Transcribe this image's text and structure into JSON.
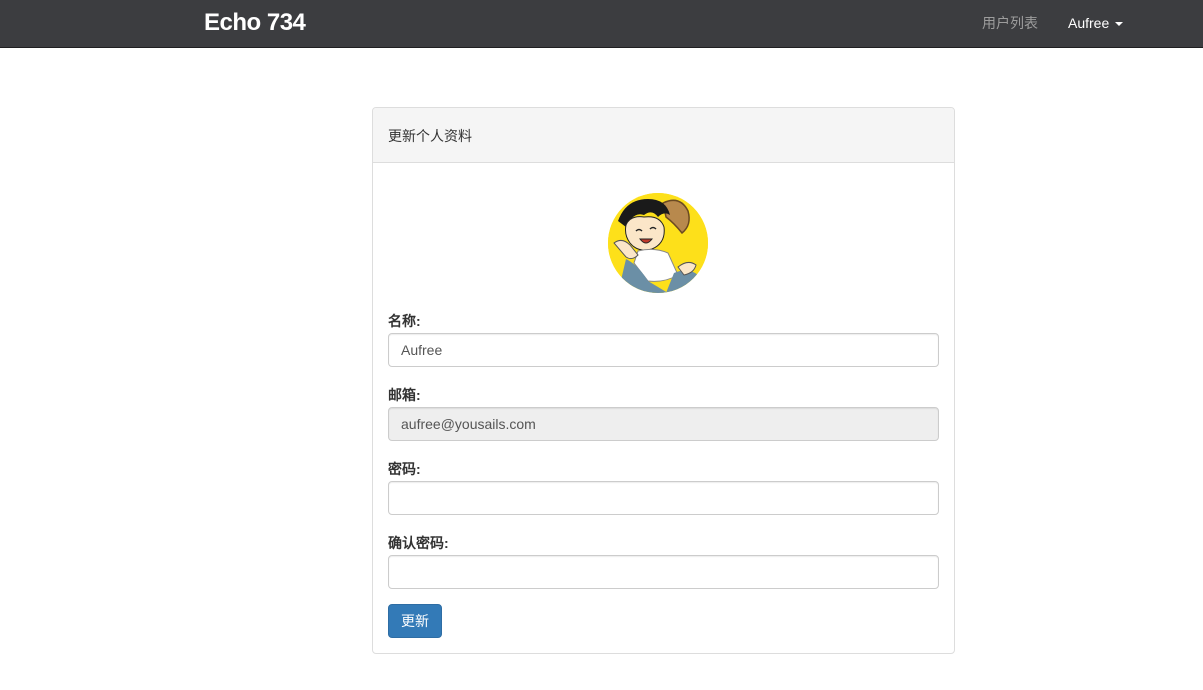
{
  "navbar": {
    "brand": "Echo 734",
    "users_link": "用户列表",
    "user_menu": "Aufree"
  },
  "panel": {
    "heading": "更新个人资料",
    "avatar_icon": "avatar-image",
    "fields": {
      "name": {
        "label": "名称:",
        "value": "Aufree"
      },
      "email": {
        "label": "邮箱:",
        "value": "aufree@yousails.com"
      },
      "password": {
        "label": "密码:",
        "value": ""
      },
      "password_confirm": {
        "label": "确认密码:",
        "value": ""
      }
    },
    "submit_label": "更新"
  },
  "colors": {
    "navbar_bg": "#3c3d40",
    "primary_button": "#337ab7",
    "avatar_bg": "#fde01a"
  }
}
